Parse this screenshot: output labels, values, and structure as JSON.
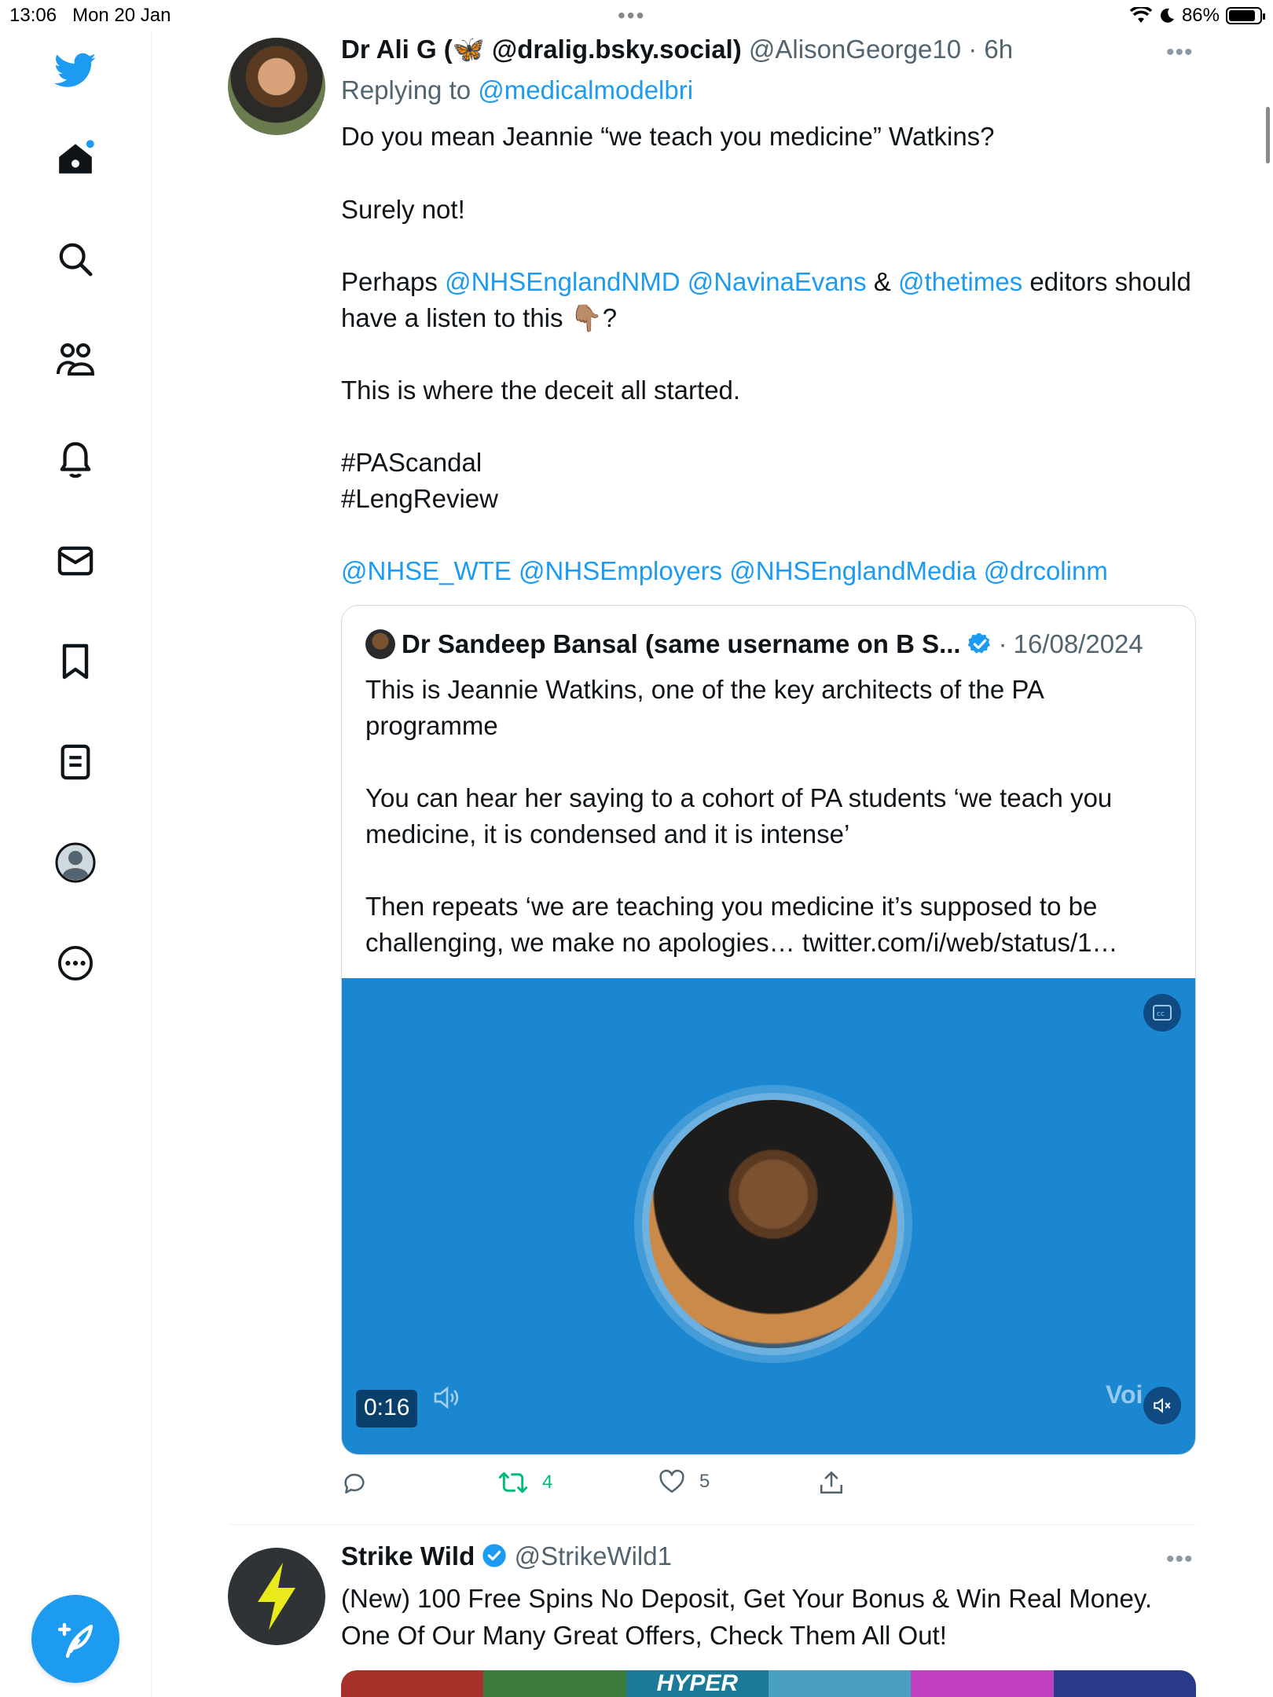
{
  "status_bar": {
    "time": "13:06",
    "date": "Mon 20 Jan",
    "battery": "86%",
    "battery_level": 0.86
  },
  "sidebar": {
    "items": [
      "twitter-logo",
      "home",
      "explore",
      "communities",
      "notifications",
      "messages",
      "bookmarks",
      "lists",
      "profile",
      "more"
    ],
    "compose_label": "Tweet"
  },
  "tweet": {
    "author_name": "Dr Ali G (",
    "author_name_emoji": "🦋",
    "author_name_rest": " @dralig.bsky.social)",
    "handle": "@AlisonGeorge10",
    "separator": "·",
    "time": "6h",
    "replying_prefix": "Replying to",
    "replying_to": "@medicalmodelbri",
    "lines": {
      "l1": "Do you mean Jeannie “we teach you medicine” Watkins?",
      "l2": "Surely not!",
      "l3_pre": "Perhaps",
      "l3_m1": "@NHSEnglandNMD",
      "l3_m2": "@NavinaEvans",
      "l3_amp": "&",
      "l3_m3": "@thetimes",
      "l3_post": "editors should",
      "l4": "have a listen to this",
      "l4_emoji": "👇🏽",
      "l4_q": "?",
      "l5": "This is where the deceit all started.",
      "tag1": "#PAScandal",
      "tag2": "#LengReview",
      "m1": "@NHSE_WTE",
      "m2": "@NHSEmployers",
      "m3": "@NHSEnglandMedia",
      "m4": "@drcolinm"
    },
    "quote": {
      "author_name": "Dr Sandeep Bansal (same username on B S...",
      "separator": "·",
      "date": "16/08/2024",
      "lines": [
        "This is Jeannie Watkins, one of the key architects of the PA",
        "programme",
        "You can hear her saying to a cohort of PA students ‘we teach you",
        "medicine, it is condensed and it is intense’",
        "Then repeats ‘we are teaching you medicine it’s supposed to be",
        "challenging, we make no apologies… twitter.com/i/web/status/1…"
      ],
      "media": {
        "duration": "0:16",
        "voice_label": "Voi",
        "bg_color": "#1a87d0"
      }
    },
    "actions": {
      "reply_count": "",
      "retweet_count": "4",
      "like_count": "5"
    }
  },
  "tweet2": {
    "author_name": "Strike Wild",
    "handle": "@StrikeWild1",
    "line1": "(New) 100 Free Spins No Deposit, Get Your Bonus & Win Real Money.",
    "line2": "One Of Our Many Great Offers, Check Them All Out!",
    "banner_text": "HYPER"
  },
  "colors": {
    "accent": "#1d9bf0",
    "retweet": "#00ba7c",
    "text": "#0f1419",
    "muted": "#536471"
  }
}
